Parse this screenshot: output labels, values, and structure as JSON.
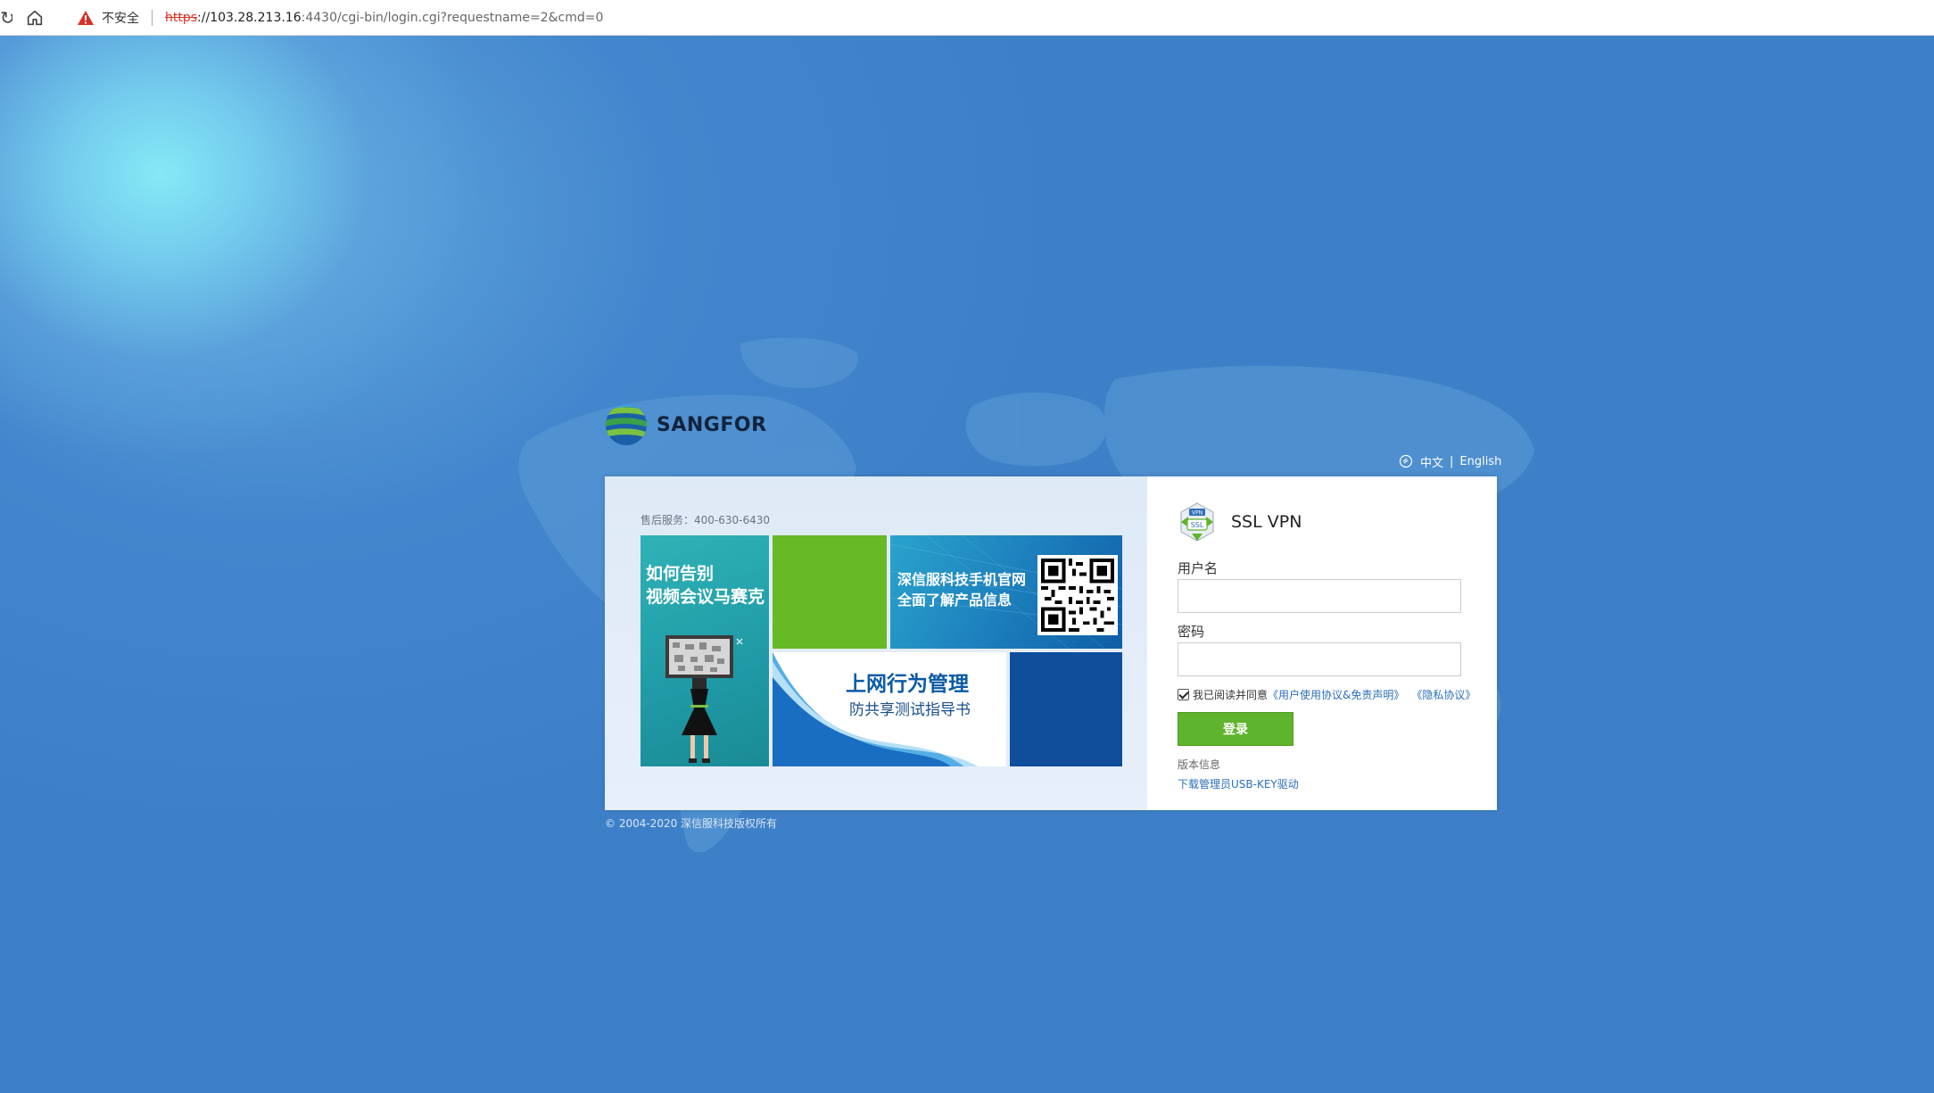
{
  "browser": {
    "reload_icon": "reload-icon",
    "home_icon": "home-icon",
    "warning_icon": "warning-triangle-icon",
    "security_label": "不安全",
    "url_protocol": "https",
    "url_host": "://103.28.213.16",
    "url_path": ":4430/cgi-bin/login.cgi?requestname=2&cmd=0"
  },
  "brand": {
    "logo_text": "SANGFOR"
  },
  "language": {
    "icon": "language-icon",
    "chinese": "中文",
    "separator": "|",
    "english": "English"
  },
  "left_panel": {
    "hotline": "售后服务：400-630-6430",
    "tile1_line1": "如何告别",
    "tile1_line2": "视频会议马赛克",
    "tile3_line1": "深信服科技手机官网",
    "tile3_line2": "全面了解产品信息",
    "tile4_title": "上网行为管理",
    "tile4_subtitle": "防共享测试指导书"
  },
  "login": {
    "product_title": "SSL VPN",
    "username_label": "用户名",
    "username_value": "",
    "password_label": "密码",
    "password_value": "",
    "agree_checked": true,
    "agree_text": "我已阅读并同意",
    "agreement_link": "《用户使用协议&免责声明》",
    "privacy_link": "《隐私协议》",
    "login_button": "登录",
    "version_info": "版本信息",
    "usbkey_link": "下载管理员USB-KEY驱动"
  },
  "footer": {
    "copyright": "© 2004-2020 深信服科技版权所有"
  },
  "colors": {
    "background": "#3e80c8",
    "login_button": "#5fb42d",
    "link": "#2d6fb8"
  }
}
